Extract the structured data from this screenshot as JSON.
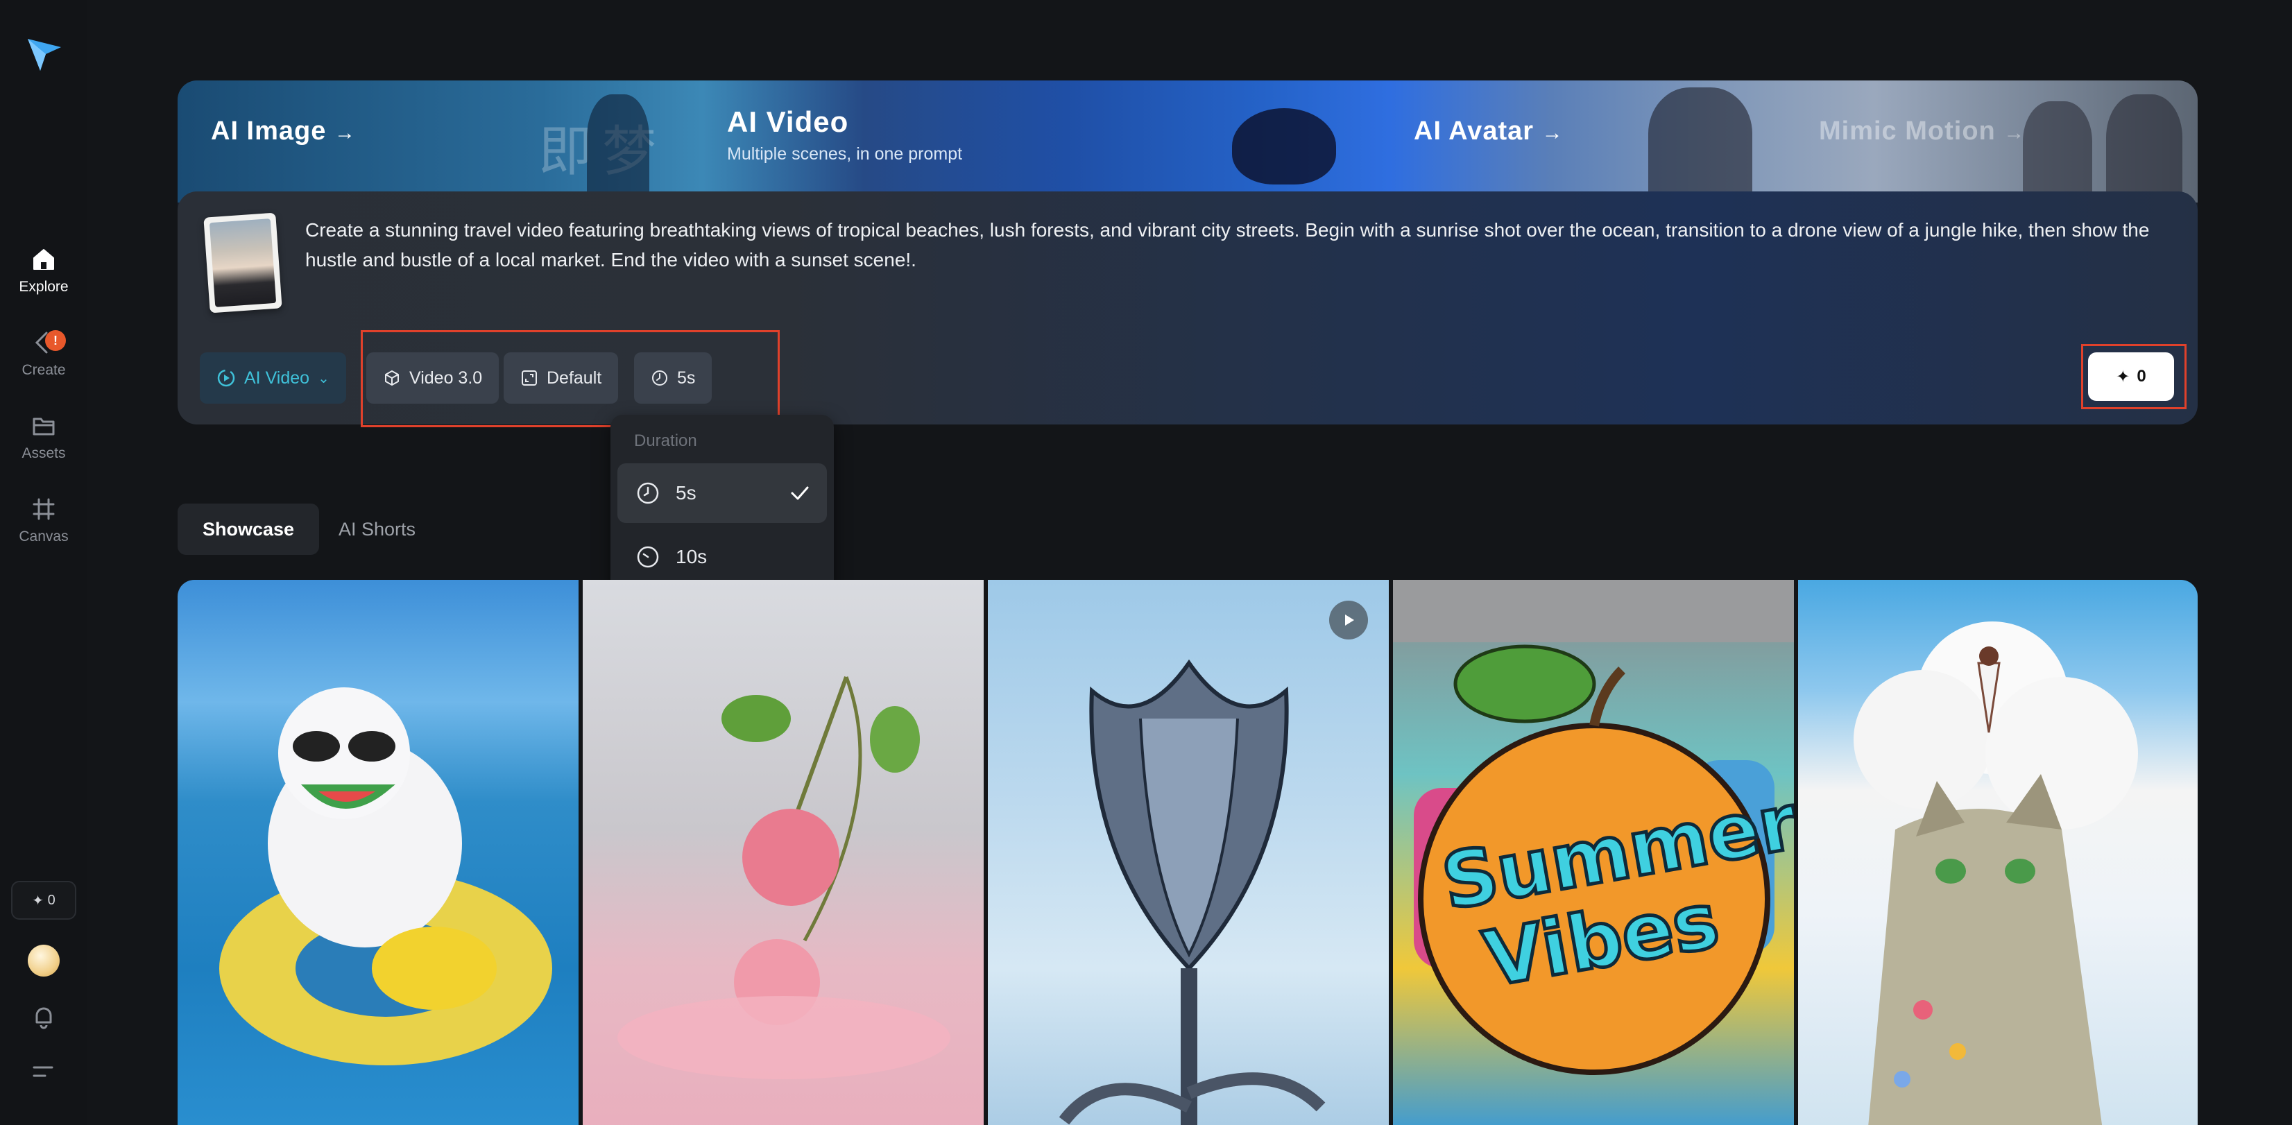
{
  "sidebar": {
    "items": [
      {
        "label": "Explore",
        "icon": "home-icon"
      },
      {
        "label": "Create",
        "icon": "create-icon",
        "badge": "!"
      },
      {
        "label": "Assets",
        "icon": "folder-icon"
      },
      {
        "label": "Canvas",
        "icon": "canvas-icon"
      }
    ],
    "credits": "0"
  },
  "hero": {
    "tabs": {
      "ai_image": "AI Image",
      "ai_video": "AI Video",
      "ai_video_sub": "Multiple scenes, in one prompt",
      "ai_avatar": "AI Avatar",
      "mimic_motion": "Mimic Motion"
    },
    "watermark_text": "即梦",
    "prompt": "Create a stunning travel video featuring breathtaking views of tropical beaches, lush forests, and vibrant city streets. Begin with a sunrise shot over the ocean, transition to a drone view of a jungle hike, then show the hustle and bustle of a local market. End the video with a sunset scene!.",
    "chips": {
      "mode": "AI Video",
      "model": "Video 3.0",
      "ratio": "Default",
      "duration": "5s"
    },
    "generate_cost": "0"
  },
  "dropdown": {
    "header": "Duration",
    "options": [
      "5s",
      "10s"
    ],
    "selected": "5s"
  },
  "feed_tabs": {
    "showcase": "Showcase",
    "ai_shorts": "AI Shorts"
  },
  "gallery": {
    "cards": [
      {
        "subject": "cat-in-pool"
      },
      {
        "subject": "cherries-splash"
      },
      {
        "subject": "chrome-tulip",
        "playable": true
      },
      {
        "subject": "summer-vibes-orange",
        "text": "Summer Vibes"
      },
      {
        "subject": "cat-cloud-girl"
      }
    ]
  },
  "colors": {
    "highlight": "#e0412b",
    "accent_teal": "#3fc1d9",
    "badge": "#e8582b"
  }
}
